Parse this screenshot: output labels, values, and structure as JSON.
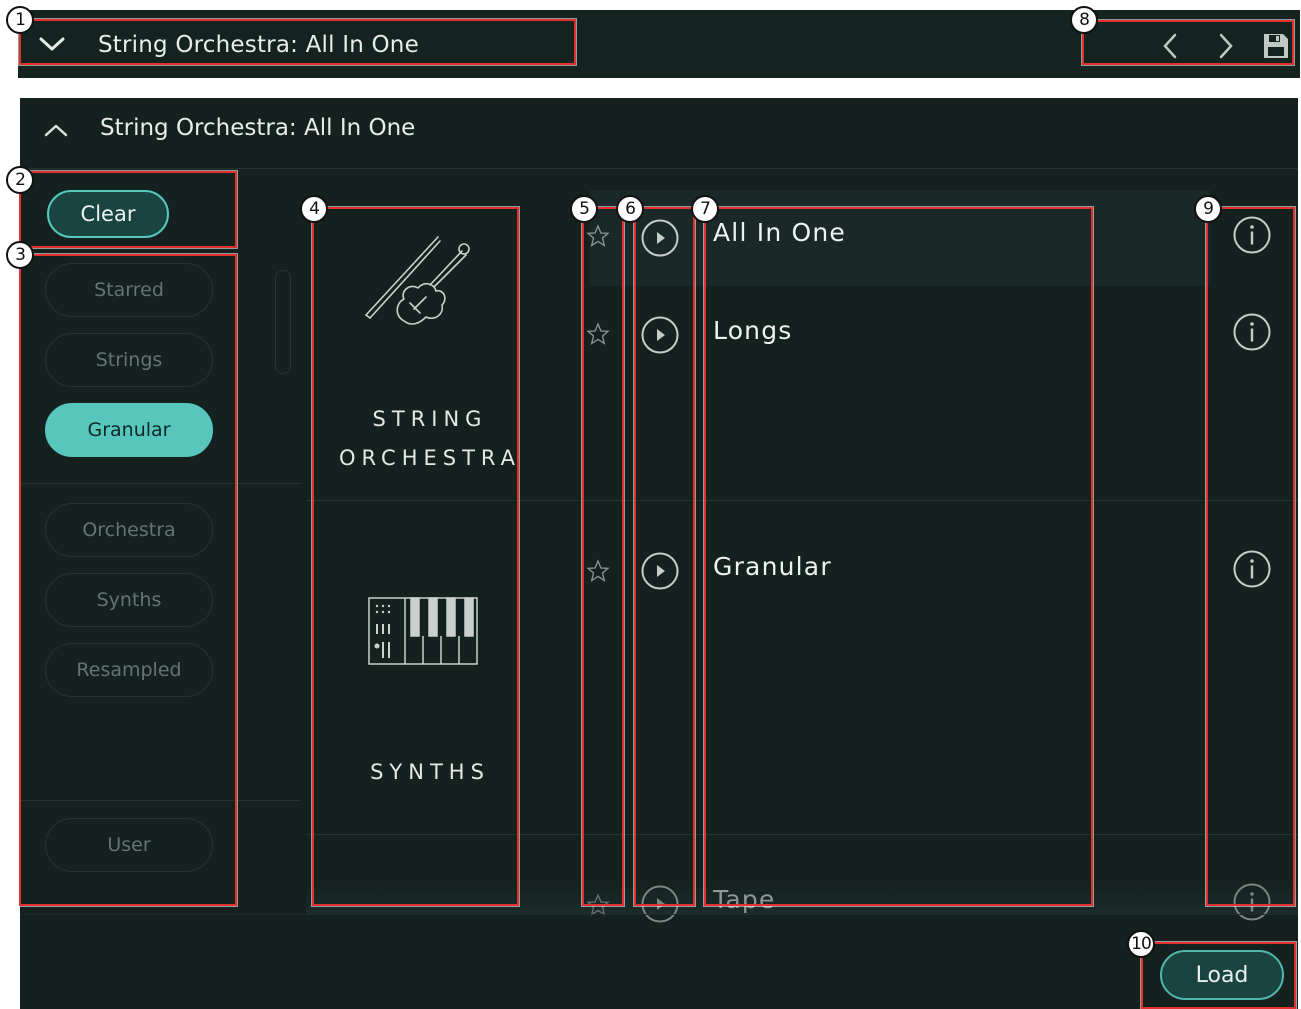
{
  "header": {
    "title": "String Orchestra: All In One"
  },
  "panel": {
    "title": "String Orchestra: All In One"
  },
  "filters": {
    "clear_label": "Clear",
    "tags_group1": [
      "Starred",
      "Strings",
      "Granular"
    ],
    "tags_group2": [
      "Orchestra",
      "Synths",
      "Resampled"
    ],
    "user_label": "User",
    "active_tag": "Granular"
  },
  "categories": [
    {
      "line1": "STRING",
      "line2": "ORCHESTRA",
      "icon": "violin-icon"
    },
    {
      "line1": "SYNTHS",
      "line2": "",
      "icon": "keyboard-synth-icon"
    }
  ],
  "presets": [
    "All In One",
    "Longs",
    "Granular",
    "Tape"
  ],
  "load_label": "Load",
  "annotations": [
    "1",
    "2",
    "3",
    "4",
    "5",
    "6",
    "7",
    "8",
    "9",
    "10"
  ],
  "colors": {
    "background": "#14211f",
    "accent": "#57c7be",
    "annotation": "#e0302f"
  }
}
